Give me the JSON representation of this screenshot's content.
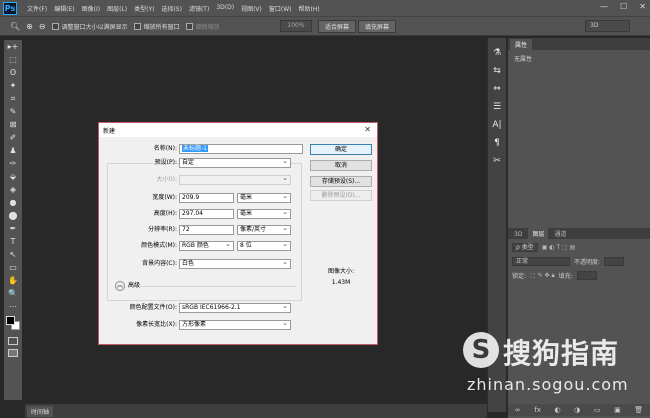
{
  "app": {
    "logo": "Ps"
  },
  "menu": [
    "文件(F)",
    "编辑(E)",
    "图像(I)",
    "图层(L)",
    "类型(Y)",
    "选择(S)",
    "滤镜(T)",
    "3D(D)",
    "视图(V)",
    "窗口(W)",
    "帮助(H)"
  ],
  "window_controls": [
    "—",
    "☐",
    "✕"
  ],
  "options": {
    "resize_windows": "调整窗口大小以满屏显示",
    "zoom_all": "缩放所有窗口",
    "scrubby_zoom": "细微缩放",
    "zoom_value": "100%",
    "fit_screen": "适合屏幕",
    "fill_screen": "填充屏幕",
    "workspace": "3D"
  },
  "tools": [
    "▸+",
    "⬚",
    "ʘ",
    "✦",
    "⌗",
    "✎",
    "⊠",
    "✐",
    "♟",
    "✑",
    "⬙",
    "◈",
    "●",
    "⬤",
    "✒",
    "T",
    "↖",
    "▭",
    "✋",
    "🔍",
    "⋯"
  ],
  "dock_icons": [
    "⚗",
    "⇆",
    "⇔",
    "☰",
    "A|",
    "¶",
    "✂"
  ],
  "properties": {
    "tab": "属性",
    "empty": "无属性"
  },
  "layers": {
    "tabs": [
      "3D",
      "图层",
      "通道"
    ],
    "filter_kind": "ρ 类型",
    "blend_mode": "正常",
    "opacity_label": "不透明度:",
    "lock_label": "锁定:",
    "fill_label": "填充:"
  },
  "layers_bottom_icons": [
    "∞",
    "fx",
    "◐",
    "◑",
    "▭",
    "▣",
    "🗑"
  ],
  "timeline": {
    "tab": "时间轴"
  },
  "dialog": {
    "title": "新建",
    "close": "✕",
    "name_label": "名称(N):",
    "name_value": "未标题-1",
    "preset_label": "预设(P):",
    "preset_value": "自定",
    "size_label": "大小(I):",
    "width_label": "宽度(W):",
    "width_value": "209.9",
    "width_unit": "毫米",
    "height_label": "高度(H):",
    "height_value": "297.04",
    "height_unit": "毫米",
    "resolution_label": "分辨率(R):",
    "resolution_value": "72",
    "resolution_unit": "像素/英寸",
    "color_mode_label": "颜色模式(M):",
    "color_mode_value": "RGB 颜色",
    "bit_depth": "8 位",
    "bg_label": "背景内容(C):",
    "bg_value": "白色",
    "advanced_label": "高级",
    "advanced_toggle": "︽",
    "color_profile_label": "颜色配置文件(O):",
    "color_profile_value": "sRGB IEC61966-2.1",
    "pixel_aspect_label": "像素长宽比(X):",
    "pixel_aspect_value": "方形像素",
    "ok": "确定",
    "cancel": "取消",
    "save_preset": "存储预设(S)...",
    "delete_preset": "删除预设(D)...",
    "image_size_label": "图像大小:",
    "image_size_value": "1.43M"
  },
  "watermark": {
    "logo": "S",
    "text": "搜狗指南",
    "url": "zhinan.sogou.com"
  }
}
